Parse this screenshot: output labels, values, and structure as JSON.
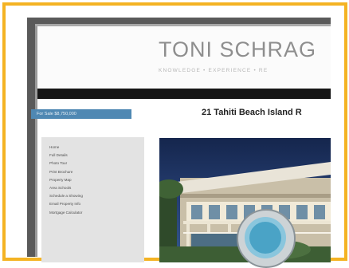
{
  "site": {
    "brand": "TONI SCHRAG",
    "tagline": "KNOWLEDGE • EXPERIENCE • RE",
    "price_label": "For Sale $8,750,000",
    "property_title": "21 Tahiti Beach Island R",
    "nav_items": [
      "Home",
      "Full Details",
      "Photo Tour",
      "Print Brochure",
      "Property Map",
      "Area Schools",
      "Schedule a Showing",
      "Email Property Info",
      "Mortgage Calculator"
    ]
  },
  "colors": {
    "frame_border": "#f4b323",
    "price_tag": "#4f88b3",
    "nav_bar": "#161616",
    "zoom_lens": "#4aa3c6"
  },
  "icons": {
    "zoom": "magnifier-zoom-icon"
  }
}
